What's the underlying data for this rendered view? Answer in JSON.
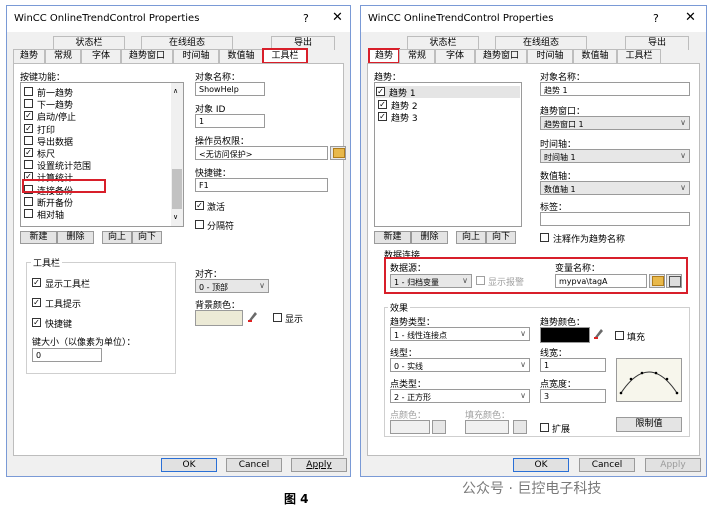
{
  "figure_caption": "图 4",
  "watermark": "公众号 · 巨控电子科技",
  "left": {
    "title": "WinCC OnlineTrendControl Properties",
    "help": "?",
    "close": "✕",
    "tabs_row1": [
      "状态栏",
      "在线组态",
      "导出"
    ],
    "tabs_row2": [
      "趋势",
      "常规",
      "字体",
      "趋势窗口",
      "时间轴",
      "数值轴",
      "工具栏"
    ],
    "key_function_label": "按键功能：",
    "key_items": [
      {
        "label": "前一趋势",
        "checked": false
      },
      {
        "label": "下一趋势",
        "checked": false
      },
      {
        "label": "启动/停止",
        "checked": true
      },
      {
        "label": "打印",
        "checked": true
      },
      {
        "label": "导出数据",
        "checked": false
      },
      {
        "label": "标尺",
        "checked": true
      },
      {
        "label": "设置统计范围",
        "checked": false
      },
      {
        "label": "计算统计",
        "checked": true
      },
      {
        "label": "连接备份",
        "checked": false
      },
      {
        "label": "断开备份",
        "checked": false
      },
      {
        "label": "相对轴",
        "checked": false
      }
    ],
    "list_buttons": [
      "新建",
      "删除",
      "向上",
      "向下"
    ],
    "object_name_label": "对象名称：",
    "object_name_value": "ShowHelp",
    "object_id_label": "对象 ID",
    "object_id_value": "1",
    "op_perm_label": "操作员权限：",
    "op_perm_value": "<无访问保护>",
    "hotkey_label": "快捷键：",
    "hotkey_value": "F1",
    "activate_label": "激活",
    "separator_label": "分隔符",
    "toolbar_group": "工具栏",
    "show_toolbar": "显示工具栏",
    "toolbar_tips": "工具提示",
    "shortcut_keys": "快捷键",
    "key_size_label": "键大小（以像素为单位）：",
    "key_size_value": "0",
    "align_label": "对齐：",
    "align_value": "0 - 顶部",
    "bg_color_label": "背景颜色：",
    "show_label": "显示",
    "ok": "OK",
    "cancel": "Cancel",
    "apply": "Apply"
  },
  "right": {
    "title": "WinCC OnlineTrendControl Properties",
    "help": "?",
    "close": "✕",
    "tabs_row1": [
      "状态栏",
      "在线组态",
      "导出"
    ],
    "tabs_row2": [
      "趋势",
      "常规",
      "字体",
      "趋势窗口",
      "时间轴",
      "数值轴",
      "工具栏"
    ],
    "trend_label": "趋势：",
    "trend_items": [
      "趋势 1",
      "趋势 2",
      "趋势 3"
    ],
    "object_name_label": "对象名称：",
    "object_name_value": "趋势 1",
    "trend_window_label": "趋势窗口：",
    "trend_window_value": "趋势窗口 1",
    "time_axis_label": "时间轴：",
    "time_axis_value": "时间轴 1",
    "value_axis_label": "数值轴：",
    "value_axis_value": "数值轴 1",
    "tag_label": "标签：",
    "list_buttons": [
      "新建",
      "删除",
      "向上",
      "向下"
    ],
    "note_label": "注释作为趋势名称",
    "data_conn_label": "数据连接",
    "data_source_label": "数据源：",
    "data_source_value": "1 - 归档变量",
    "show_alarm_label": "显示报警",
    "var_name_label": "变量名称：",
    "var_name_value": "mypva\\tagA",
    "effect_group": "效果",
    "trend_type_label": "趋势类型：",
    "trend_type_value": "1 - 线性连接点",
    "trend_color_label": "趋势颜色：",
    "fill_label": "填充",
    "line_type_label": "线型：",
    "line_type_value": "0 - 实线",
    "line_width_label": "线宽：",
    "line_width_value": "1",
    "point_type_label": "点类型：",
    "point_type_value": "2 - 正方形",
    "point_width_label": "点宽度：",
    "point_width_value": "3",
    "point_color_label": "点颜色：",
    "fill_color_label": "填充颜色：",
    "extend_label": "扩展",
    "limit_label": "限制值",
    "ok": "OK",
    "cancel": "Cancel",
    "apply": "Apply"
  }
}
